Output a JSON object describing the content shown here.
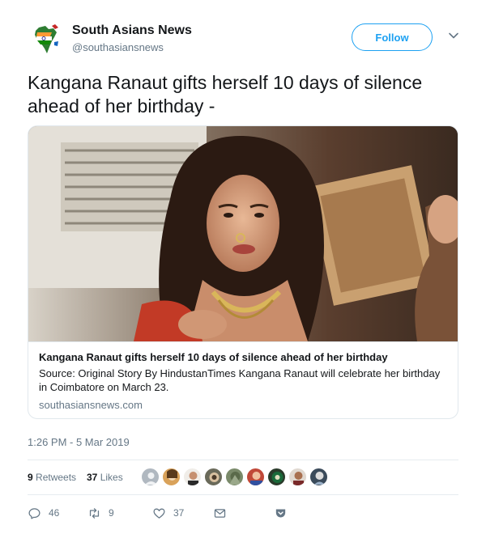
{
  "author": {
    "name": "South Asians News",
    "handle": "@southasiansnews",
    "avatar_icon": "south-asia-map-flag-icon"
  },
  "follow_label": "Follow",
  "tweet_text": "Kangana Ranaut gifts herself 10 days of silence ahead of her birthday -",
  "card": {
    "title": "Kangana Ranaut gifts herself 10 days of silence ahead of her birthday",
    "description": "Source: Original Story By HindustanTimes Kangana Ranaut will celebrate her birthday in Coimbatore on March 23.",
    "domain": "southasiansnews.com"
  },
  "timestamp": "1:26 PM - 5 Mar 2019",
  "stats": {
    "retweets_count": "9",
    "retweets_label": "Retweets",
    "likes_count": "37",
    "likes_label": "Likes"
  },
  "actions": {
    "reply_count": "46",
    "retweet_count": "9",
    "like_count": "37"
  },
  "colors": {
    "accent": "#1da1f2",
    "secondary_text": "#657786",
    "primary_text": "#14171a",
    "border": "#e1e8ed"
  }
}
